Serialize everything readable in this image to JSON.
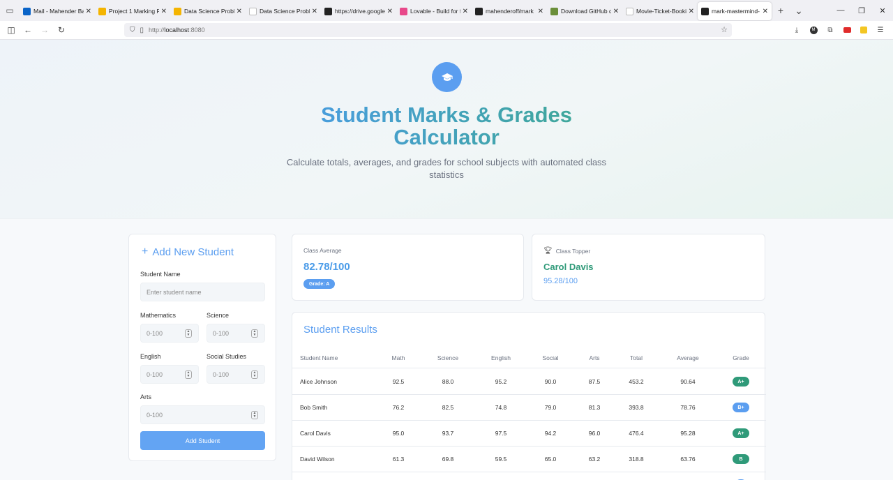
{
  "browser": {
    "tabs": [
      {
        "title": "Mail - Mahender Ba",
        "icon": "outlook-icon",
        "color": "#0a64c8",
        "active": false
      },
      {
        "title": "Project 1 Marking P",
        "icon": "google-drive-icon",
        "color": "#f4b400",
        "active": false
      },
      {
        "title": "Data Science Proble",
        "icon": "google-drive-icon",
        "color": "#f4b400",
        "active": false
      },
      {
        "title": "Data Science Problem S",
        "icon": "blank-page-icon",
        "color": "#ffffff",
        "active": false
      },
      {
        "title": "https://drive.google",
        "icon": "notion-icon",
        "color": "#222222",
        "active": false
      },
      {
        "title": "Lovable - Build for f",
        "icon": "lovable-icon",
        "color": "#e8488a",
        "active": false
      },
      {
        "title": "mahenderoff/mark",
        "icon": "github-icon",
        "color": "#222222",
        "active": false
      },
      {
        "title": "Download GitHub d",
        "icon": "download-icon",
        "color": "#6b8f3a",
        "active": false
      },
      {
        "title": "Movie-Ticket-Booking-",
        "icon": "blank-page-icon",
        "color": "#ffffff",
        "active": false
      },
      {
        "title": "mark-mastermind-",
        "icon": "lovable-sparkle-icon",
        "color": "#222222",
        "active": true
      }
    ],
    "url_scheme": "http://",
    "url_host": "localhost",
    "url_port": ":8080"
  },
  "hero": {
    "title": "Student Marks & Grades Calculator",
    "subtitle": "Calculate totals, averages, and grades for school subjects with automated class statistics"
  },
  "form": {
    "title": "Add New Student",
    "name_label": "Student Name",
    "name_placeholder": "Enter student name",
    "math_label": "Mathematics",
    "science_label": "Science",
    "english_label": "English",
    "social_label": "Social Studies",
    "arts_label": "Arts",
    "score_placeholder": "0-100",
    "submit_label": "Add Student"
  },
  "stats": {
    "average_label": "Class Average",
    "average_value": "82.78/100",
    "average_grade": "Grade: A",
    "topper_label": "Class Topper",
    "topper_name": "Carol Davis",
    "topper_score": "95.28/100"
  },
  "results": {
    "title": "Student Results",
    "columns": [
      "Student Name",
      "Math",
      "Science",
      "English",
      "Social",
      "Arts",
      "Total",
      "Average",
      "Grade"
    ],
    "rows": [
      {
        "name": "Alice Johnson",
        "math": "92.5",
        "science": "88.0",
        "english": "95.2",
        "social": "90.0",
        "arts": "87.5",
        "total": "453.2",
        "average": "90.64",
        "grade": "A+",
        "grade_color": "#2f9a79"
      },
      {
        "name": "Bob Smith",
        "math": "76.2",
        "science": "82.5",
        "english": "74.8",
        "social": "79.0",
        "arts": "81.3",
        "total": "393.8",
        "average": "78.76",
        "grade": "B+",
        "grade_color": "#5b9ef0"
      },
      {
        "name": "Carol Davis",
        "math": "95.0",
        "science": "93.7",
        "english": "97.5",
        "social": "94.2",
        "arts": "96.0",
        "total": "476.4",
        "average": "95.28",
        "grade": "A+",
        "grade_color": "#2f9a79"
      },
      {
        "name": "David Wilson",
        "math": "61.3",
        "science": "69.8",
        "english": "59.5",
        "social": "65.0",
        "arts": "63.2",
        "total": "318.8",
        "average": "63.76",
        "grade": "B",
        "grade_color": "#2f9a79"
      }
    ]
  },
  "colors": {
    "primary": "#5b9ef0",
    "accent_green": "#2f9a79"
  }
}
